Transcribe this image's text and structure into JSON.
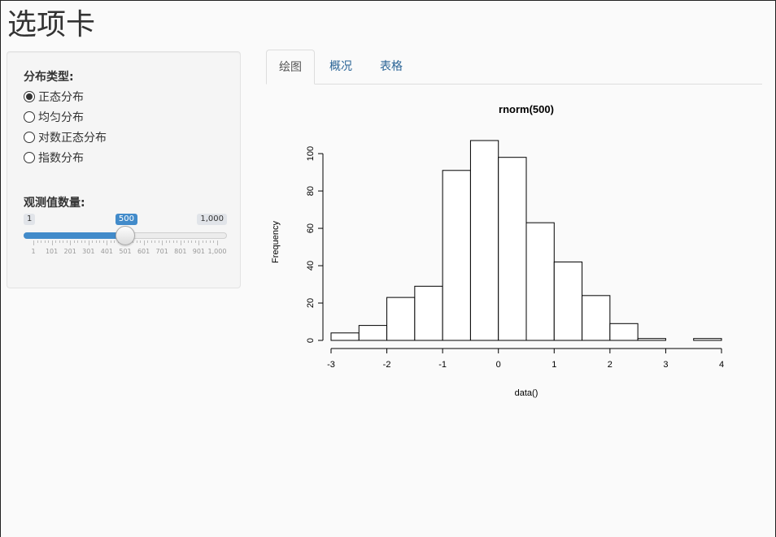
{
  "page_title": "选项卡",
  "sidebar": {
    "dist_label": "分布类型:",
    "options": [
      {
        "label": "正态分布",
        "selected": true
      },
      {
        "label": "均匀分布",
        "selected": false
      },
      {
        "label": "对数正态分布",
        "selected": false
      },
      {
        "label": "指数分布",
        "selected": false
      }
    ],
    "n_label": "观测值数量:",
    "slider": {
      "min": 1,
      "max": 1000,
      "value": 500,
      "min_label": "1",
      "max_label": "1,000",
      "value_label": "500",
      "grid_labels": [
        "1",
        "101",
        "201",
        "301",
        "401",
        "501",
        "601",
        "701",
        "801",
        "901",
        "1,000"
      ]
    }
  },
  "tabs": [
    {
      "label": "绘图",
      "active": true
    },
    {
      "label": "概况",
      "active": false
    },
    {
      "label": "表格",
      "active": false
    }
  ],
  "chart_data": {
    "type": "bar",
    "title": "rnorm(500)",
    "xlabel": "data()",
    "ylabel": "Frequency",
    "bin_edges": [
      -3,
      -2.5,
      -2,
      -1.5,
      -1,
      -0.5,
      0,
      0.5,
      1,
      1.5,
      2,
      2.5,
      3,
      3.5,
      4
    ],
    "values": [
      4,
      8,
      23,
      29,
      91,
      107,
      98,
      63,
      42,
      24,
      9,
      1,
      0,
      1
    ],
    "xlim": [
      -3,
      4
    ],
    "ylim": [
      0,
      107
    ],
    "x_ticks": [
      "-3",
      "-2",
      "-1",
      "0",
      "1",
      "2",
      "3",
      "4"
    ],
    "y_ticks": [
      "0",
      "20",
      "40",
      "60",
      "80",
      "100"
    ],
    "grid": false
  }
}
